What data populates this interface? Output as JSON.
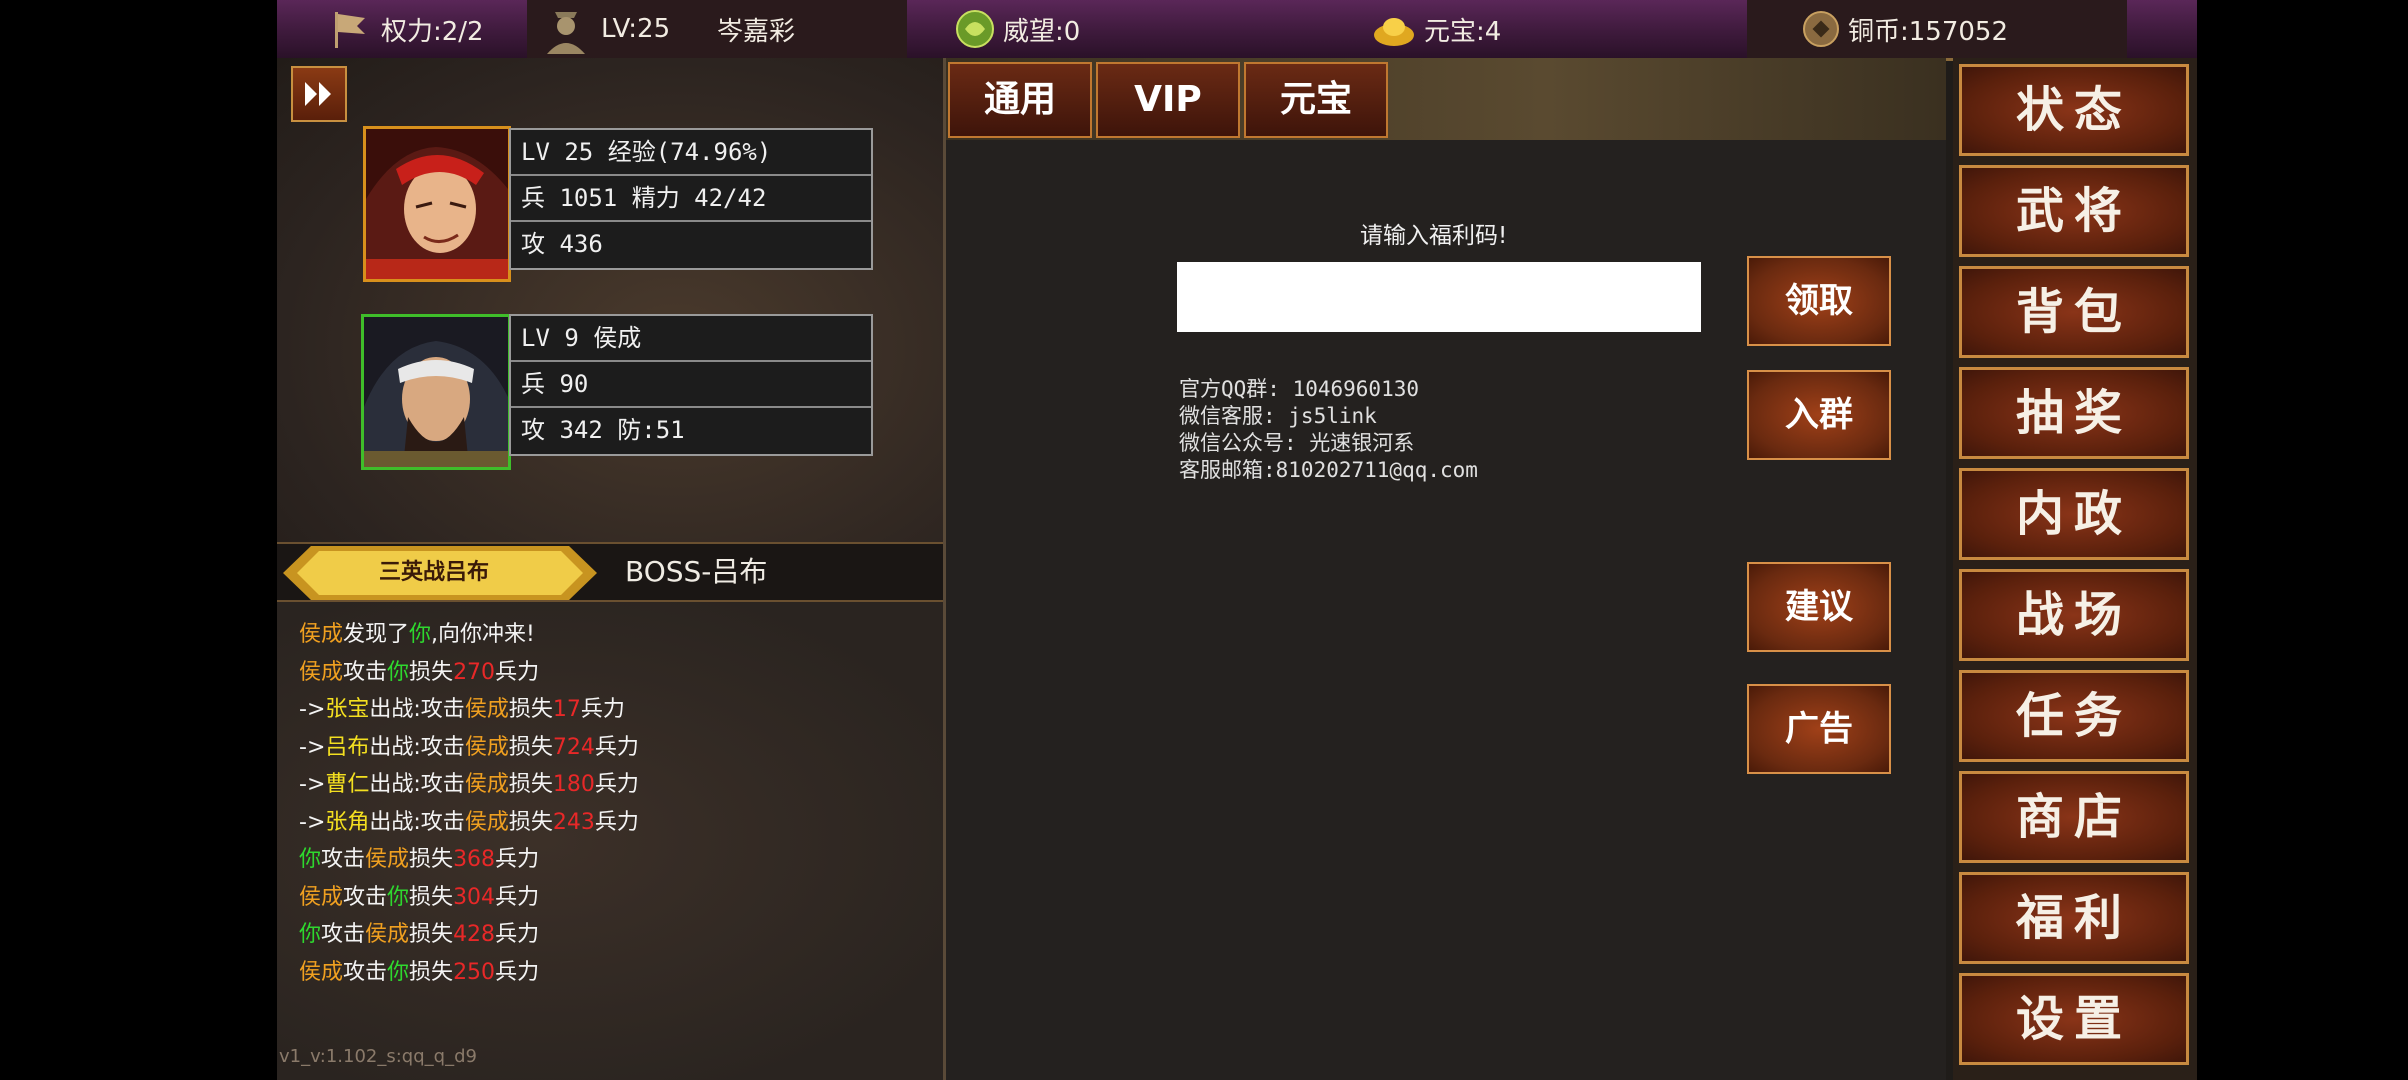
{
  "topbar": {
    "power": "权力:2/2",
    "level": "LV:25",
    "player_name": "岑嘉彩",
    "prestige": "威望:0",
    "yuanbao": "元宝:4",
    "copper": "铜币:157052"
  },
  "hero_main": {
    "row1": "LV 25 经验(74.96%)",
    "row2": "兵 1051 精力 42/42",
    "row3": "攻 436"
  },
  "hero_enemy": {
    "row1": "LV 9  侯成",
    "row2": "兵 90",
    "row3": "攻 342 防:51"
  },
  "battle": {
    "banner": "三英战吕布",
    "boss": "BOSS-吕布",
    "log": [
      [
        {
          "t": "侯成",
          "c": "o"
        },
        {
          "t": "发现了",
          "c": "w"
        },
        {
          "t": "你",
          "c": "g"
        },
        {
          "t": ",向你冲来!",
          "c": "w"
        }
      ],
      [
        {
          "t": "侯成",
          "c": "o"
        },
        {
          "t": "攻击",
          "c": "w"
        },
        {
          "t": "你",
          "c": "g"
        },
        {
          "t": "损失",
          "c": "w"
        },
        {
          "t": "270",
          "c": "r"
        },
        {
          "t": "兵力",
          "c": "w"
        }
      ],
      [
        {
          "t": "->",
          "c": "w"
        },
        {
          "t": "张宝",
          "c": "y"
        },
        {
          "t": "出战:攻击",
          "c": "w"
        },
        {
          "t": "侯成",
          "c": "o"
        },
        {
          "t": "损失",
          "c": "w"
        },
        {
          "t": "17",
          "c": "r"
        },
        {
          "t": "兵力",
          "c": "w"
        }
      ],
      [
        {
          "t": "->",
          "c": "w"
        },
        {
          "t": "吕布",
          "c": "y"
        },
        {
          "t": "出战:攻击",
          "c": "w"
        },
        {
          "t": "侯成",
          "c": "o"
        },
        {
          "t": "损失",
          "c": "w"
        },
        {
          "t": "724",
          "c": "r"
        },
        {
          "t": "兵力",
          "c": "w"
        }
      ],
      [
        {
          "t": "->",
          "c": "w"
        },
        {
          "t": "曹仁",
          "c": "y"
        },
        {
          "t": "出战:攻击",
          "c": "w"
        },
        {
          "t": "侯成",
          "c": "o"
        },
        {
          "t": "损失",
          "c": "w"
        },
        {
          "t": "180",
          "c": "r"
        },
        {
          "t": "兵力",
          "c": "w"
        }
      ],
      [
        {
          "t": "->",
          "c": "w"
        },
        {
          "t": "张角",
          "c": "y"
        },
        {
          "t": "出战:攻击",
          "c": "w"
        },
        {
          "t": "侯成",
          "c": "o"
        },
        {
          "t": "损失",
          "c": "w"
        },
        {
          "t": "243",
          "c": "r"
        },
        {
          "t": "兵力",
          "c": "w"
        }
      ],
      [
        {
          "t": "你",
          "c": "g"
        },
        {
          "t": "攻击",
          "c": "w"
        },
        {
          "t": "侯成",
          "c": "o"
        },
        {
          "t": "损失",
          "c": "w"
        },
        {
          "t": "368",
          "c": "r"
        },
        {
          "t": "兵力",
          "c": "w"
        }
      ],
      [
        {
          "t": "侯成",
          "c": "o"
        },
        {
          "t": "攻击",
          "c": "w"
        },
        {
          "t": "你",
          "c": "g"
        },
        {
          "t": "损失",
          "c": "w"
        },
        {
          "t": "304",
          "c": "r"
        },
        {
          "t": "兵力",
          "c": "w"
        }
      ],
      [
        {
          "t": "你",
          "c": "g"
        },
        {
          "t": "攻击",
          "c": "w"
        },
        {
          "t": "侯成",
          "c": "o"
        },
        {
          "t": "损失",
          "c": "w"
        },
        {
          "t": "428",
          "c": "r"
        },
        {
          "t": "兵力",
          "c": "w"
        }
      ],
      [
        {
          "t": "侯成",
          "c": "o"
        },
        {
          "t": "攻击",
          "c": "w"
        },
        {
          "t": "你",
          "c": "g"
        },
        {
          "t": "损失",
          "c": "w"
        },
        {
          "t": "250",
          "c": "r"
        },
        {
          "t": "兵力",
          "c": "w"
        }
      ]
    ]
  },
  "version": "v1_v:1.102_s:qq_q_d9",
  "tabs": [
    "通用",
    "VIP",
    "元宝"
  ],
  "welfare": {
    "prompt": "请输入福利码!",
    "input_value": "",
    "info": [
      "官方QQ群: 1046960130",
      "微信客服: js5link",
      "微信公众号: 光速银河系",
      "客服邮箱:810202711@qq.com"
    ],
    "buttons": [
      "领取",
      "入群",
      "建议",
      "广告"
    ]
  },
  "menu": [
    "状态",
    "武将",
    "背包",
    "抽奖",
    "内政",
    "战场",
    "任务",
    "商店",
    "福利",
    "设置"
  ],
  "colors": {
    "orange_name": "#f0a020",
    "you_green": "#2ed82e",
    "damage_red": "#e82828",
    "ally_yellow": "#f4e020"
  }
}
